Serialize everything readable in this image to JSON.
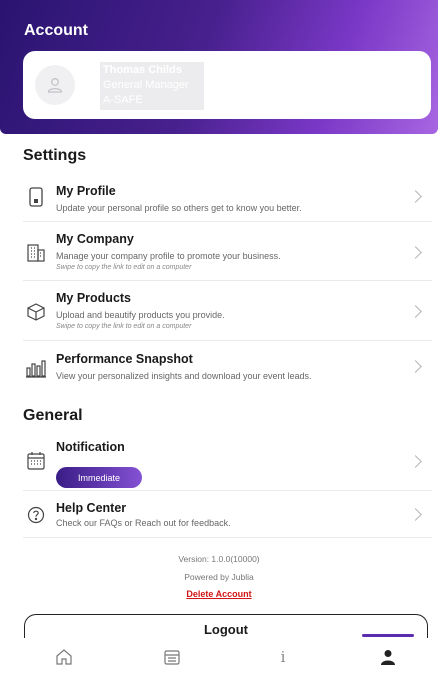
{
  "header": {
    "title": "Account"
  },
  "profile": {
    "name": "Thomas Childs",
    "role": "General Manager",
    "company": "A-SAFE"
  },
  "settings": {
    "title": "Settings",
    "items": [
      {
        "title": "My Profile",
        "desc": "Update your personal profile so others get to know you better.",
        "note": "",
        "icon": "phone-icon"
      },
      {
        "title": "My Company",
        "desc": "Manage your company profile to promote your business.",
        "note": "Swipe to copy the link to edit on a computer",
        "icon": "building-icon"
      },
      {
        "title": "My Products",
        "desc": "Upload and beautify products you provide.",
        "note": "Swipe to copy the link to edit on a computer",
        "icon": "cube-icon"
      },
      {
        "title": "Performance Snapshot",
        "desc": "View your personalized insights and download your event leads.",
        "note": "",
        "icon": "bar-chart-icon"
      }
    ]
  },
  "general": {
    "title": "General",
    "notification": {
      "title": "Notification",
      "badge": "Immediate",
      "icon": "calendar-icon"
    },
    "help": {
      "title": "Help Center",
      "desc": "Check our FAQs or Reach out for feedback.",
      "icon": "question-circle-icon"
    }
  },
  "footer": {
    "version": "Version: 1.0.0(10000)",
    "powered": "Powered by Jublia",
    "delete": "Delete Account"
  },
  "logout": "Logout",
  "tabs": [
    {
      "name": "home",
      "icon": "home-icon"
    },
    {
      "name": "agenda",
      "icon": "calendar-list-icon"
    },
    {
      "name": "info",
      "icon": "info-icon",
      "label": "i"
    },
    {
      "name": "account",
      "icon": "person-icon",
      "active": true
    }
  ],
  "colors": {
    "accent": "#5a2db0",
    "danger": "#d21414",
    "header_start": "#2a1470",
    "header_end": "#a866e2"
  }
}
